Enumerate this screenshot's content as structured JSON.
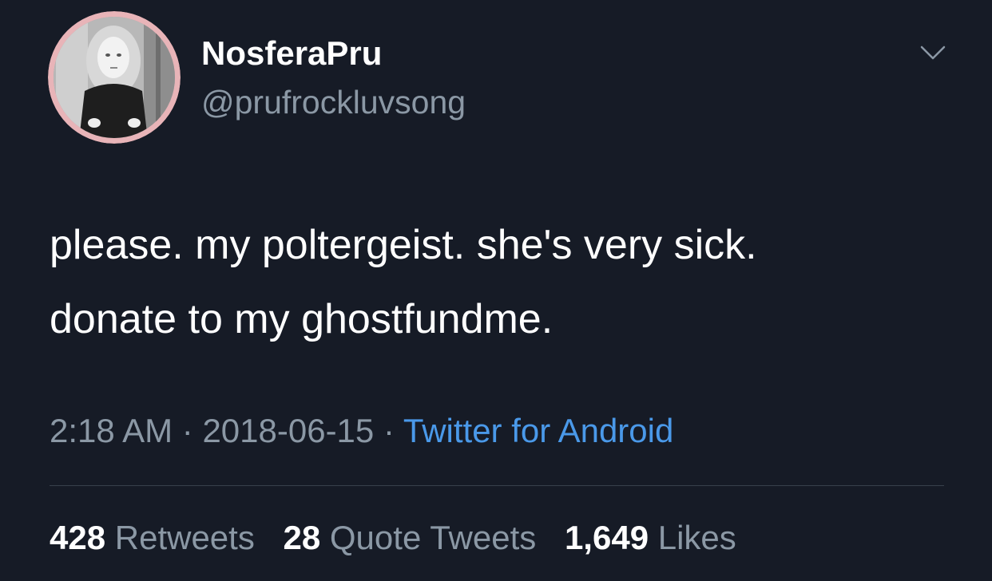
{
  "user": {
    "display_name": "NosferaPru",
    "handle": "@prufrockluvsong",
    "avatar_icon": "user-avatar-photo",
    "avatar_ring_color": "#e8b4b8"
  },
  "tweet": {
    "text_line_1": "please. my poltergeist. she's very sick.",
    "text_line_2": "donate to my ghostfundme."
  },
  "meta": {
    "time": "2:18 AM",
    "sep1": " · ",
    "date": "2018-06-15",
    "sep2": " · ",
    "source": "Twitter for Android",
    "source_color": "#4a99e9"
  },
  "stats": {
    "retweets_count": "428",
    "retweets_label": "Retweets",
    "quotes_count": "28",
    "quotes_label": "Quote Tweets",
    "likes_count": "1,649",
    "likes_label": "Likes"
  },
  "menu": {
    "caret_icon": "chevron-down-icon"
  },
  "colors": {
    "background": "#161b26",
    "secondary_text": "#8b98a5",
    "divider": "#38404c"
  }
}
